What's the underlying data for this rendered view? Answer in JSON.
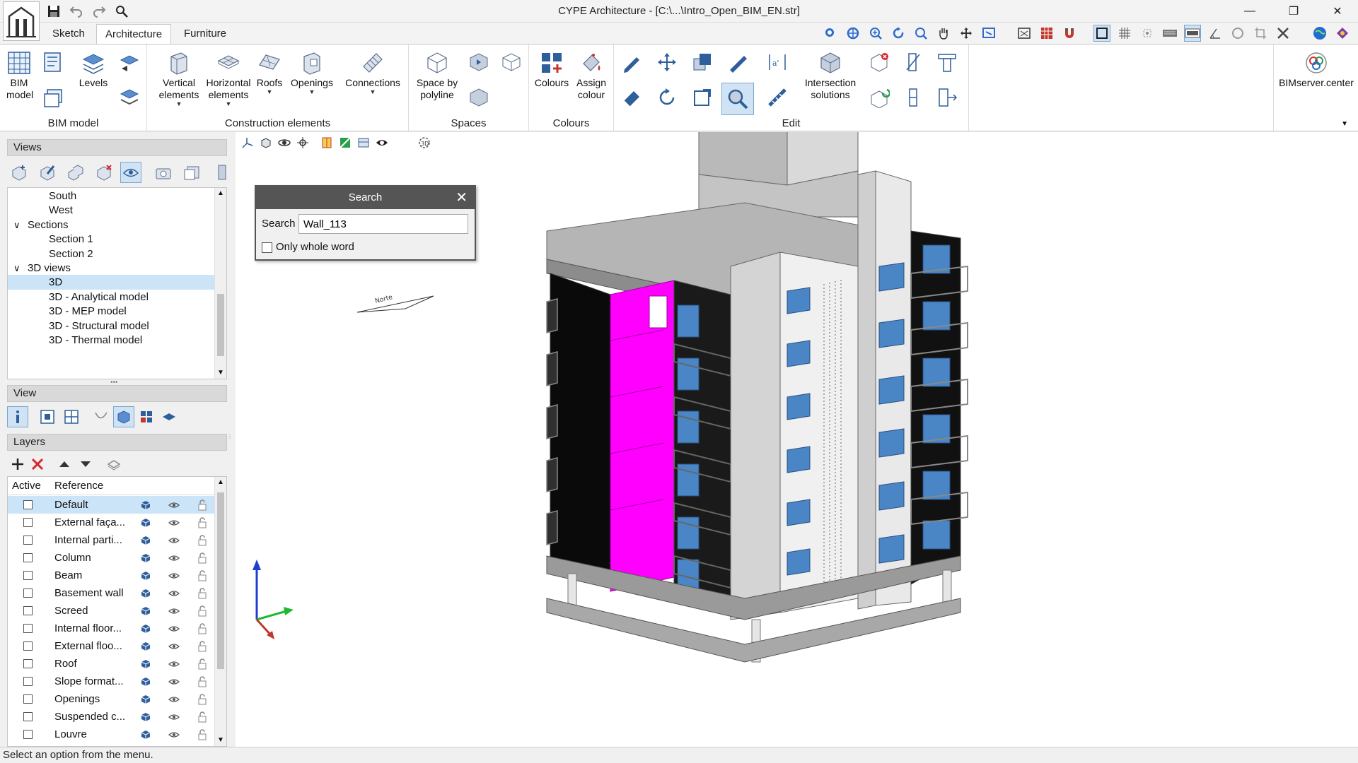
{
  "window": {
    "title": "CYPE Architecture - [C:\\...\\Intro_Open_BIM_EN.str]",
    "minimize": "—",
    "restore": "❐",
    "close": "✕"
  },
  "tabs": [
    "Sketch",
    "Architecture",
    "Furniture"
  ],
  "ribbon": {
    "bim_model": {
      "label": "BIM model",
      "btn_bim": "BIM model",
      "btn_levels": "Levels"
    },
    "construction": {
      "label": "Construction elements",
      "vertical": "Vertical elements",
      "horizontal": "Horizontal elements",
      "roofs": "Roofs",
      "openings": "Openings",
      "connections": "Connections"
    },
    "spaces": {
      "label": "Spaces",
      "space_by_polyline": "Space by polyline"
    },
    "colours": {
      "label": "Colours",
      "colours": "Colours",
      "assign_colour": "Assign colour"
    },
    "edit": {
      "label": "Edit",
      "intersection": "Intersection solutions"
    },
    "bimserver": {
      "label": "BIMserver.center"
    }
  },
  "views_panel": {
    "header": "Views",
    "tree": [
      {
        "label": "South",
        "level": 2,
        "expander": ""
      },
      {
        "label": "West",
        "level": 2,
        "expander": ""
      },
      {
        "label": "Sections",
        "level": 1,
        "expander": "∨"
      },
      {
        "label": "Section 1",
        "level": 2,
        "expander": ""
      },
      {
        "label": "Section 2",
        "level": 2,
        "expander": ""
      },
      {
        "label": "3D views",
        "level": 1,
        "expander": "∨"
      },
      {
        "label": "3D",
        "level": 2,
        "expander": "",
        "selected": true
      },
      {
        "label": "3D - Analytical model",
        "level": 2,
        "expander": ""
      },
      {
        "label": "3D - MEP model",
        "level": 2,
        "expander": ""
      },
      {
        "label": "3D - Structural model",
        "level": 2,
        "expander": ""
      },
      {
        "label": "3D - Thermal model",
        "level": 2,
        "expander": ""
      }
    ]
  },
  "view_panel": {
    "header": "View"
  },
  "layers_panel": {
    "header": "Layers",
    "col_active": "Active",
    "col_reference": "Reference",
    "rows": [
      "Default",
      "External faça...",
      "Internal parti...",
      "Column",
      "Beam",
      "Basement wall",
      "Screed",
      "Internal floor...",
      "External floo...",
      "Roof",
      "Slope format...",
      "Openings",
      "Suspended c...",
      "Louvre"
    ]
  },
  "search_dialog": {
    "title": "Search",
    "close": "✕",
    "label": "Search",
    "value": "Wall_113",
    "whole_word_label": "Only whole word"
  },
  "viewport": {
    "north_label": "Norte"
  },
  "status": "Select an option from the menu.",
  "colors": {
    "highlight": "#ff00ff",
    "glass": "#4a86c5",
    "accent_blue": "#1c6fd1",
    "selection": "#cce4f7"
  }
}
